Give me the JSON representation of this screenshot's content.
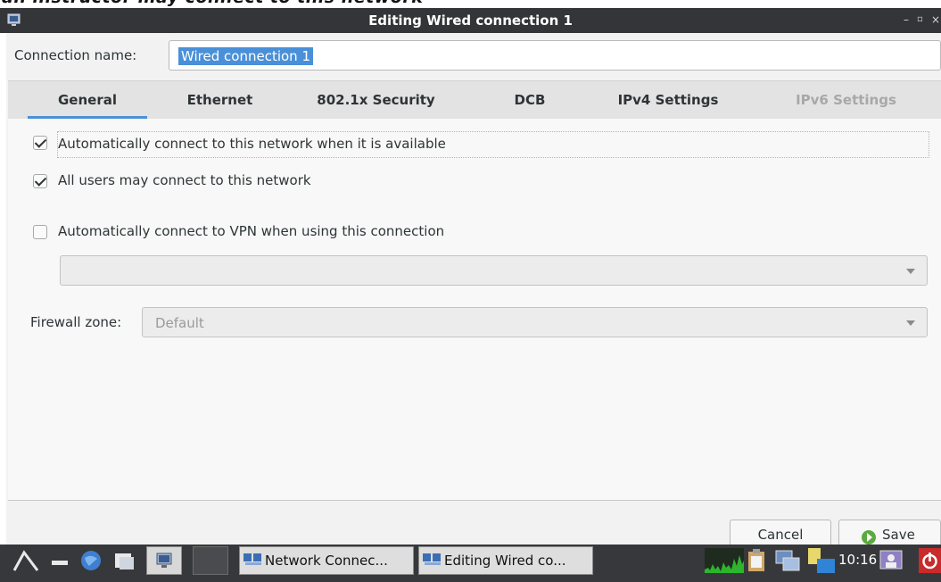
{
  "window": {
    "title": "Editing Wired connection 1",
    "icon": "network-config-icon"
  },
  "connection": {
    "label": "Connection name:",
    "value": "Wired connection 1"
  },
  "tabs": [
    {
      "label": "General",
      "active": true
    },
    {
      "label": "Ethernet"
    },
    {
      "label": "802.1x Security"
    },
    {
      "label": "DCB"
    },
    {
      "label": "IPv4 Settings"
    },
    {
      "label": "IPv6 Settings",
      "disabled": true
    }
  ],
  "general": {
    "auto_connect": {
      "label": "Automatically connect to this network when it is available",
      "checked": true
    },
    "all_users": {
      "label": "All users may connect to this network",
      "checked": true
    },
    "auto_vpn": {
      "label": "Automatically connect to VPN when using this connection",
      "checked": false
    },
    "vpn_select_value": "",
    "firewall_label": "Firewall zone:",
    "firewall_value": "Default"
  },
  "buttons": {
    "cancel": "Cancel",
    "save": "Save"
  },
  "taskbar": {
    "tasks": [
      "Network Connec...",
      "Editing Wired co..."
    ],
    "clock": "10:16"
  },
  "colors": {
    "accent": "#4a90d9",
    "titlebar": "#343538",
    "taskbar": "#37383b"
  }
}
